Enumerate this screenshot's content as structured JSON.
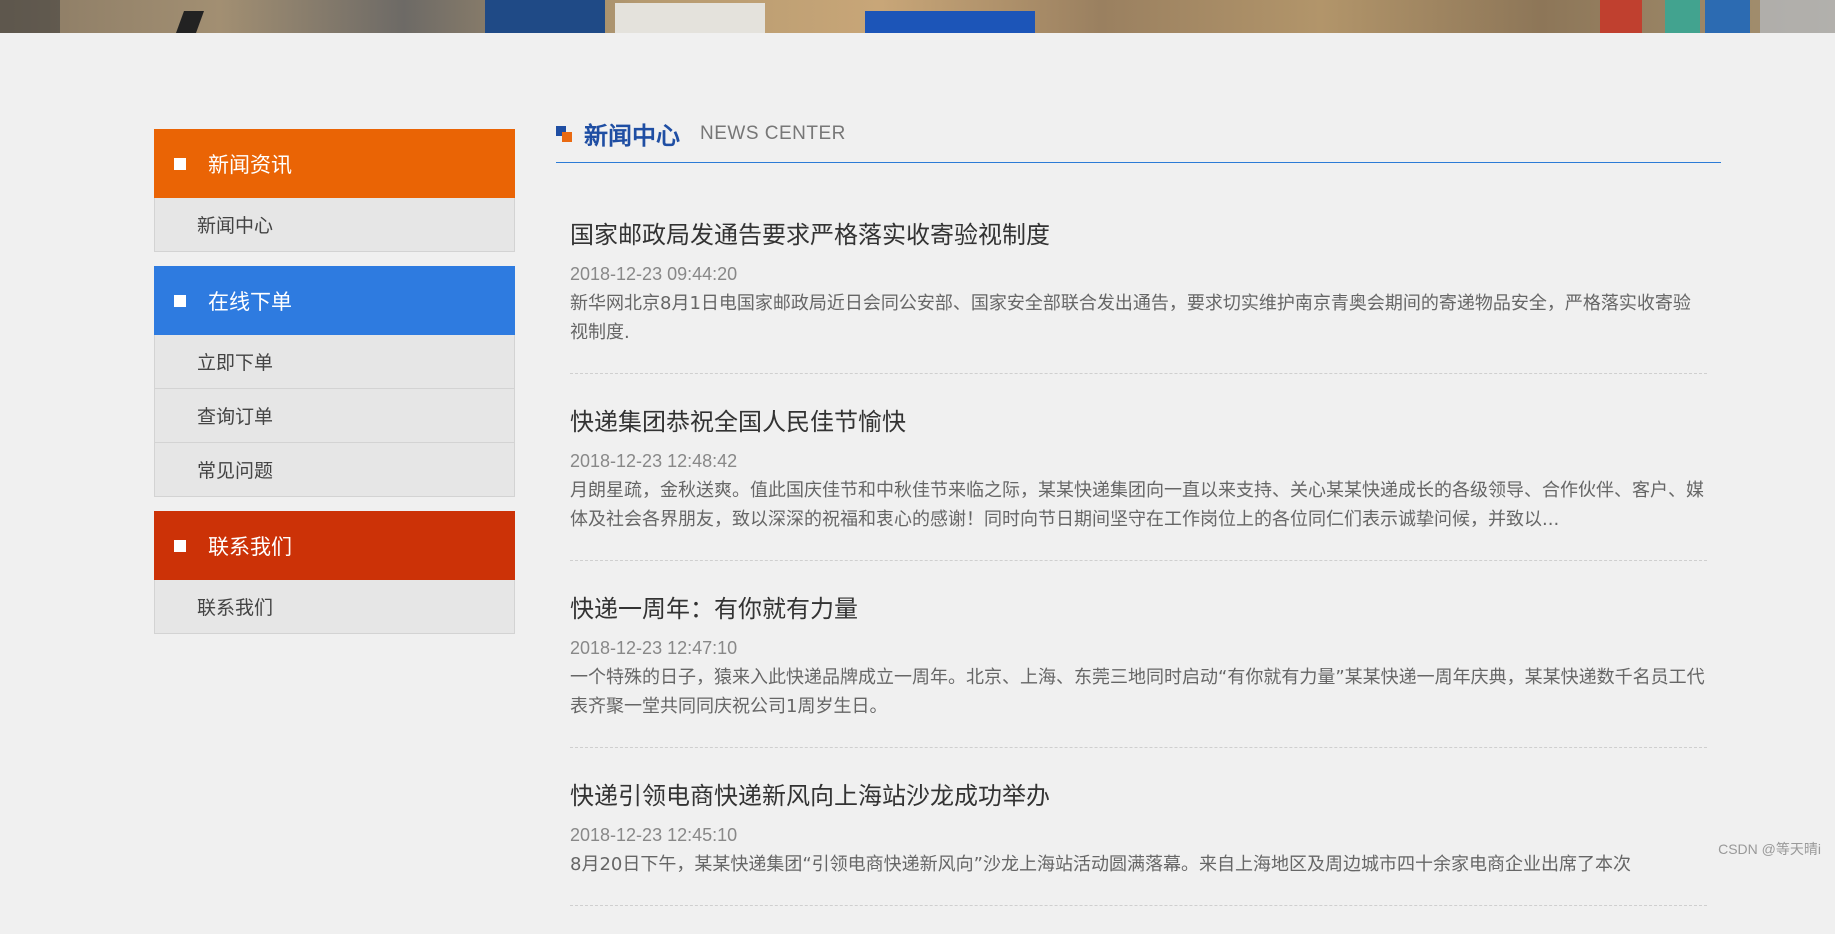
{
  "sidebar": {
    "groups": [
      {
        "title": "新闻资讯",
        "color": "#ea6405",
        "items": [
          "新闻中心"
        ]
      },
      {
        "title": "在线下单",
        "color": "#2e7be0",
        "items": [
          "立即下单",
          "查询订单",
          "常见问题"
        ]
      },
      {
        "title": "联系我们",
        "color": "#cc3207",
        "items": [
          "联系我们"
        ]
      }
    ]
  },
  "main": {
    "title": "新闻中心",
    "subtitle": "NEWS CENTER",
    "news": [
      {
        "title": "国家邮政局发通告要求严格落实收寄验视制度",
        "date": "2018-12-23 09:44:20",
        "desc": "新华网北京8月1日电国家邮政局近日会同公安部、国家安全部联合发出通告，要求切实维护南京青奥会期间的寄递物品安全，严格落实收寄验视制度."
      },
      {
        "title": "快递集团恭祝全国人民佳节愉快",
        "date": "2018-12-23 12:48:42",
        "desc": "月朗星疏，金秋送爽。值此国庆佳节和中秋佳节来临之际，某某快递集团向一直以来支持、关心某某快递成长的各级领导、合作伙伴、客户、媒体及社会各界朋友，致以深深的祝福和衷心的感谢！同时向节日期间坚守在工作岗位上的各位同仁们表示诚挚问候，并致以..."
      },
      {
        "title": "快递一周年：有你就有力量",
        "date": "2018-12-23 12:47:10",
        "desc": "一个特殊的日子，猿来入此快递品牌成立一周年。北京、上海、东莞三地同时启动“有你就有力量”某某快递一周年庆典，某某快递数千名员工代表齐聚一堂共同同庆祝公司1周岁生日。"
      },
      {
        "title": "快递引领电商快递新风向上海站沙龙成功举办",
        "date": "2018-12-23 12:45:10",
        "desc": "8月20日下午，某某快递集团“引领电商快递新风向”沙龙上海站活动圆满落幕。来自上海地区及周边城市四十余家电商企业出席了本次"
      }
    ]
  },
  "watermark": "CSDN @等天晴i"
}
